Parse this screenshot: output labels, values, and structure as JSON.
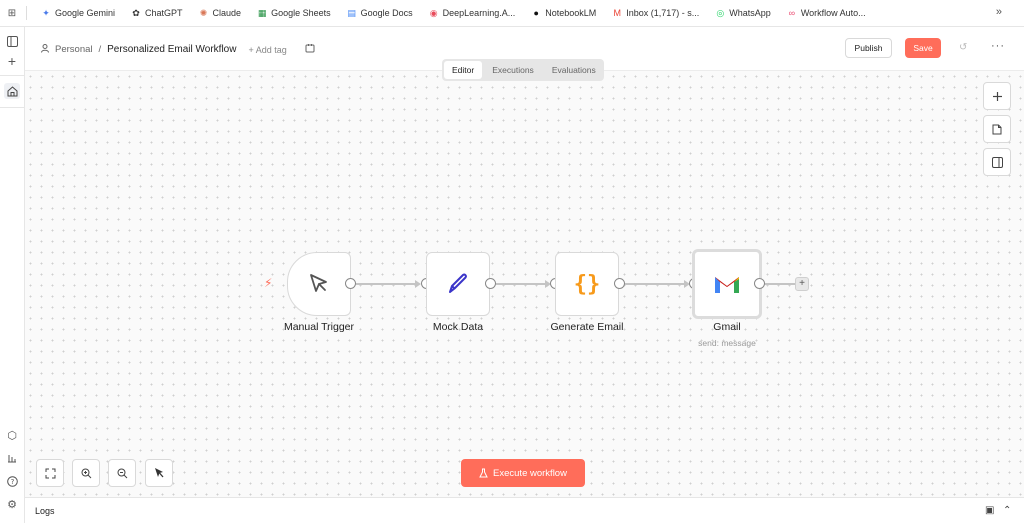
{
  "bookmarks": [
    {
      "label": "Google Gemini",
      "icon": "gemini-icon",
      "glyph": "✦",
      "color": "#4a7bea"
    },
    {
      "label": "ChatGPT",
      "icon": "chatgpt-icon",
      "glyph": "✿",
      "color": "#333333"
    },
    {
      "label": "Claude",
      "icon": "claude-icon",
      "glyph": "✺",
      "color": "#d97757"
    },
    {
      "label": "Google Sheets",
      "icon": "sheets-icon",
      "glyph": "▦",
      "color": "#1e8e3e"
    },
    {
      "label": "Google Docs",
      "icon": "docs-icon",
      "glyph": "▤",
      "color": "#4285f4"
    },
    {
      "label": "DeepLearning.A...",
      "icon": "deeplearning-icon",
      "glyph": "◉",
      "color": "#e84c5c"
    },
    {
      "label": "NotebookLM",
      "icon": "notebooklm-icon",
      "glyph": "●",
      "color": "#111111"
    },
    {
      "label": "Inbox (1,717) - s...",
      "icon": "gmail-icon",
      "glyph": "M",
      "color": "#ea4335"
    },
    {
      "label": "WhatsApp",
      "icon": "whatsapp-icon",
      "glyph": "◎",
      "color": "#25d366"
    },
    {
      "label": "Workflow Auto...",
      "icon": "n8n-icon",
      "glyph": "∞",
      "color": "#ea4b71"
    }
  ],
  "header": {
    "project": "Personal",
    "separator": "/",
    "workflow_name": "Personalized Email Workflow",
    "add_tag": "+ Add tag",
    "publish_label": "Publish",
    "save_label": "Save",
    "more": "···"
  },
  "tabs": [
    {
      "label": "Editor",
      "active": true
    },
    {
      "label": "Executions",
      "active": false
    },
    {
      "label": "Evaluations",
      "active": false
    }
  ],
  "nodes": [
    {
      "label": "Manual Trigger",
      "icon": "cursor-icon"
    },
    {
      "label": "Mock Data",
      "icon": "pencil-icon"
    },
    {
      "label": "Generate Email",
      "icon": "code-braces-icon"
    },
    {
      "label": "Gmail",
      "subtitle": "send: message",
      "icon": "gmail-icon"
    }
  ],
  "execute_label": "Execute workflow",
  "logs_label": "Logs",
  "colors": {
    "accent": "#ff6d5a",
    "braces": "#f79a1b",
    "pencil": "#3b35c9"
  }
}
